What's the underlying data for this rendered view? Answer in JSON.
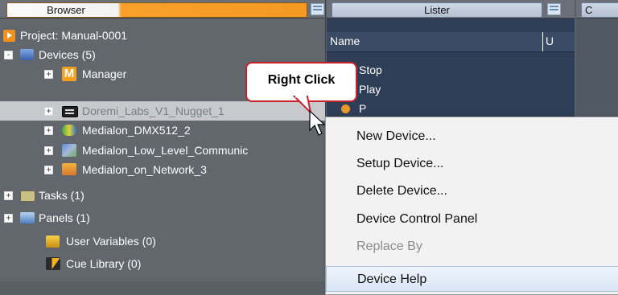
{
  "browser": {
    "tab_label": "Browser",
    "project": "Project: Manual-0001",
    "tree": [
      {
        "label": "Devices (5)",
        "icon": "devices-icon",
        "expander": "-"
      },
      {
        "label": "Manager",
        "icon": "manager-m-icon",
        "expander": "+"
      },
      {
        "label": "Doremi_Labs_V1_Nugget_1",
        "icon": "doremi-device-icon",
        "expander": "+"
      },
      {
        "label": "Medialon_DMX512_2",
        "icon": "dmx-icon",
        "expander": "+"
      },
      {
        "label": "Medialon_Low_Level_Communic",
        "icon": "low-level-comm-icon",
        "expander": "+"
      },
      {
        "label": "Medialon_on_Network_3",
        "icon": "network-icon",
        "expander": "+"
      },
      {
        "label": "Tasks (1)",
        "icon": "tasks-icon",
        "expander": "+"
      },
      {
        "label": "Panels (1)",
        "icon": "panels-icon",
        "expander": "+"
      },
      {
        "label": "User Variables (0)",
        "icon": "user-variables-icon",
        "expander": ""
      },
      {
        "label": "Cue Library (0)",
        "icon": "cue-library-icon",
        "expander": ""
      }
    ]
  },
  "lister": {
    "tab_label": "Lister",
    "columns": [
      "Name",
      "U"
    ],
    "rows": [
      "Stop",
      "Play",
      "P"
    ]
  },
  "third_panel": {
    "tab_label": "C"
  },
  "callout": {
    "text": "Right Click"
  },
  "context_menu": {
    "items": [
      {
        "label": "New Device...",
        "enabled": true
      },
      {
        "label": "Setup Device...",
        "enabled": true
      },
      {
        "label": "Delete Device...",
        "enabled": true
      },
      {
        "label": "Device Control Panel",
        "enabled": true
      },
      {
        "label": "Replace By",
        "enabled": false
      },
      {
        "label": "Device Help",
        "enabled": true
      }
    ]
  },
  "colors": {
    "accent_orange": "#f39a22",
    "callout_border": "#c9202a",
    "lister_bg": "#2f3e56"
  }
}
